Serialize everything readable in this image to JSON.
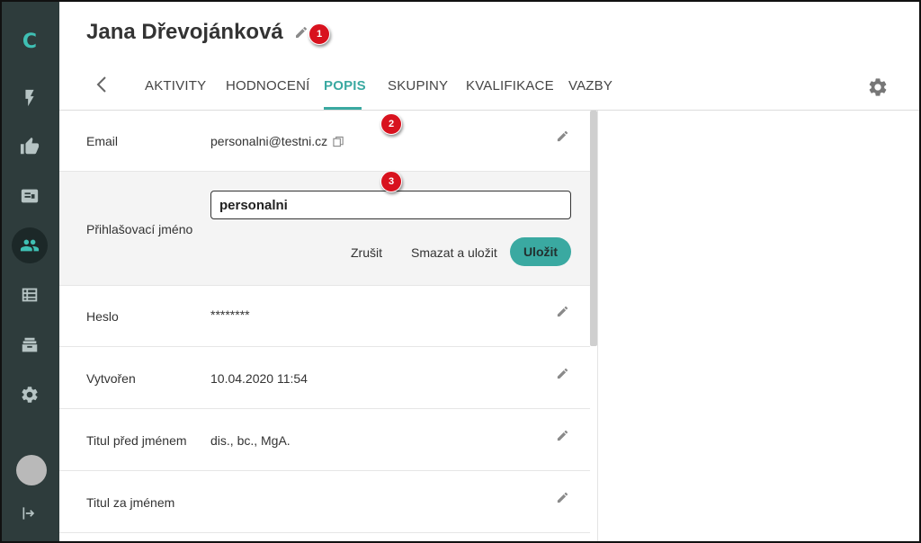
{
  "app": {
    "logo_letter": "C"
  },
  "sidebar": {
    "items": [
      {
        "icon": "bolt-icon",
        "label": "activity"
      },
      {
        "icon": "thumbs-up-icon",
        "label": "rating"
      },
      {
        "icon": "id-card-icon",
        "label": "cards"
      },
      {
        "icon": "users-icon",
        "label": "users",
        "active": true
      },
      {
        "icon": "table-icon",
        "label": "tables"
      },
      {
        "icon": "archive-icon",
        "label": "archive"
      },
      {
        "icon": "gear-icon",
        "label": "settings"
      }
    ]
  },
  "header": {
    "title": "Jana Dřevojánková"
  },
  "badges": [
    "1",
    "2",
    "3"
  ],
  "tabs": [
    {
      "label": "AKTIVITY"
    },
    {
      "label": "HODNOCENÍ"
    },
    {
      "label": "POPIS",
      "active": true
    },
    {
      "label": "SKUPINY"
    },
    {
      "label": "KVALIFIKACE"
    },
    {
      "label": "VAZBY"
    }
  ],
  "fields": {
    "email": {
      "label": "Email",
      "value": "personalni@testni.cz"
    },
    "login": {
      "label": "Přihlašovací jméno",
      "value": "personalni",
      "cancel_label": "Zrušit",
      "delete_save_label": "Smazat a uložit",
      "save_label": "Uložit"
    },
    "password": {
      "label": "Heslo",
      "value": "********"
    },
    "created": {
      "label": "Vytvořen",
      "value": "10.04.2020 11:54"
    },
    "title_before": {
      "label": "Titul před jménem",
      "value": "dis., bc., MgA."
    },
    "title_after": {
      "label": "Titul za jménem",
      "value": ""
    }
  },
  "colors": {
    "accent": "#3aa9a1",
    "sidebar_bg": "#2e3c3c",
    "badge": "#d8121e",
    "editing_row_bg": "#f4f4f4"
  }
}
